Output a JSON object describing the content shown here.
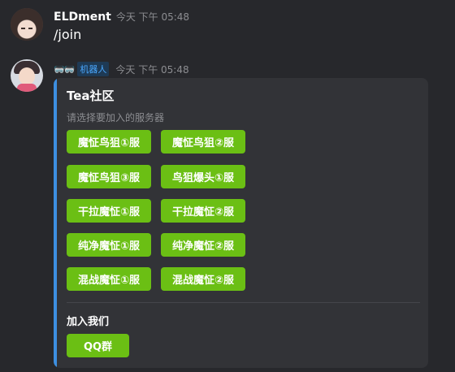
{
  "messages": [
    {
      "author": "ELDment",
      "time": "今天 下午 05:48",
      "text": "/join"
    },
    {
      "author_badges": "🥽🥽",
      "bot_tag": "机器人",
      "time": "今天 下午 05:48",
      "card": {
        "title": "Tea社区",
        "subtitle": "请选择要加入的服务器",
        "server_buttons": [
          "魔怔鸟狙①服",
          "魔怔鸟狙②服",
          "魔怔鸟狙③服",
          "鸟狙爆头①服",
          "干拉魔怔①服",
          "干拉魔怔②服",
          "纯净魔怔①服",
          "纯净魔怔②服",
          "混战魔怔①服",
          "混战魔怔②服"
        ],
        "join_title": "加入我们",
        "join_button": "QQ群"
      }
    }
  ],
  "colors": {
    "background": "#27282c",
    "card": "#323337",
    "accent_bar": "#3d8fe0",
    "button": "#6bbf14",
    "bot_tag_text": "#4aa8ff"
  }
}
